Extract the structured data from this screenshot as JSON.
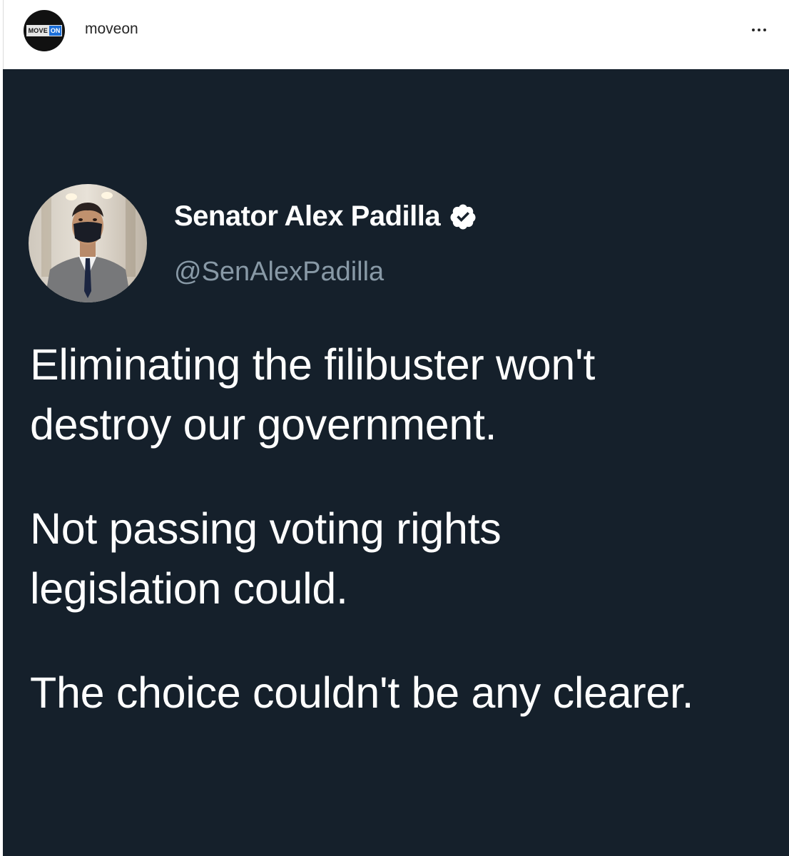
{
  "post_header": {
    "account_name": "moveon",
    "avatar_icon": "moveon-logo-icon",
    "logo": {
      "move": "MOVE",
      "on": "ON",
      "accent_color": "#1c6fd9"
    },
    "more_icon": "more-options-icon"
  },
  "tweet": {
    "avatar_icon": "profile-photo",
    "display_name": "Senator Alex Padilla",
    "verified_icon": "verified-badge-icon",
    "handle": "@SenAlexPadilla",
    "paragraphs": [
      "Eliminating the filibuster won't\ndestroy our government.",
      "Not passing voting rights\nlegislation could.",
      "The choice couldn't be any clearer."
    ],
    "background_color": "#15202b",
    "handle_color": "#8899a6"
  }
}
